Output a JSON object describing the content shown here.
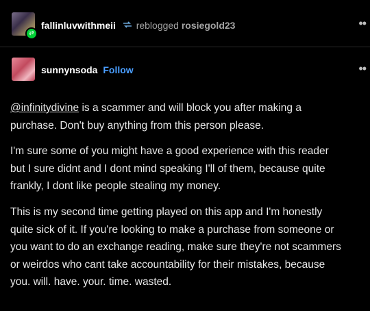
{
  "reblog": {
    "reblogger": "fallinluvwithmeii",
    "action": "reblogged",
    "original_poster": "rosiegold23",
    "more": "••"
  },
  "author": {
    "name": "sunnynsoda",
    "follow_label": "Follow",
    "more": "••"
  },
  "post": {
    "p1_mention": "@infinitydivine",
    "p1_line1_rest": " is a scammer and will block you after making a",
    "p1_line2": "purchase.  Don't buy anything from this person please.",
    "p2_lines": [
      "I'm sure some of you might have a good experience with this reader",
      "but I sure didnt and I dont mind speaking I'll of them, because quite",
      "frankly, I dont like people stealing my money."
    ],
    "p3_lines": [
      "This is my second time getting played on this app and I'm honestly",
      "quite sick of it. If you're looking to make a purchase from someone or",
      "you want to do an exchange reading, make sure they're not scammers",
      "or weirdos who cant take accountability for their mistakes, because",
      "you. will. have. your. time. wasted."
    ]
  },
  "colors": {
    "background": "#000000",
    "text": "#e8e8e8",
    "muted": "#a3a3a3",
    "link": "#4a9eff",
    "reblog_badge": "#00cf35"
  }
}
